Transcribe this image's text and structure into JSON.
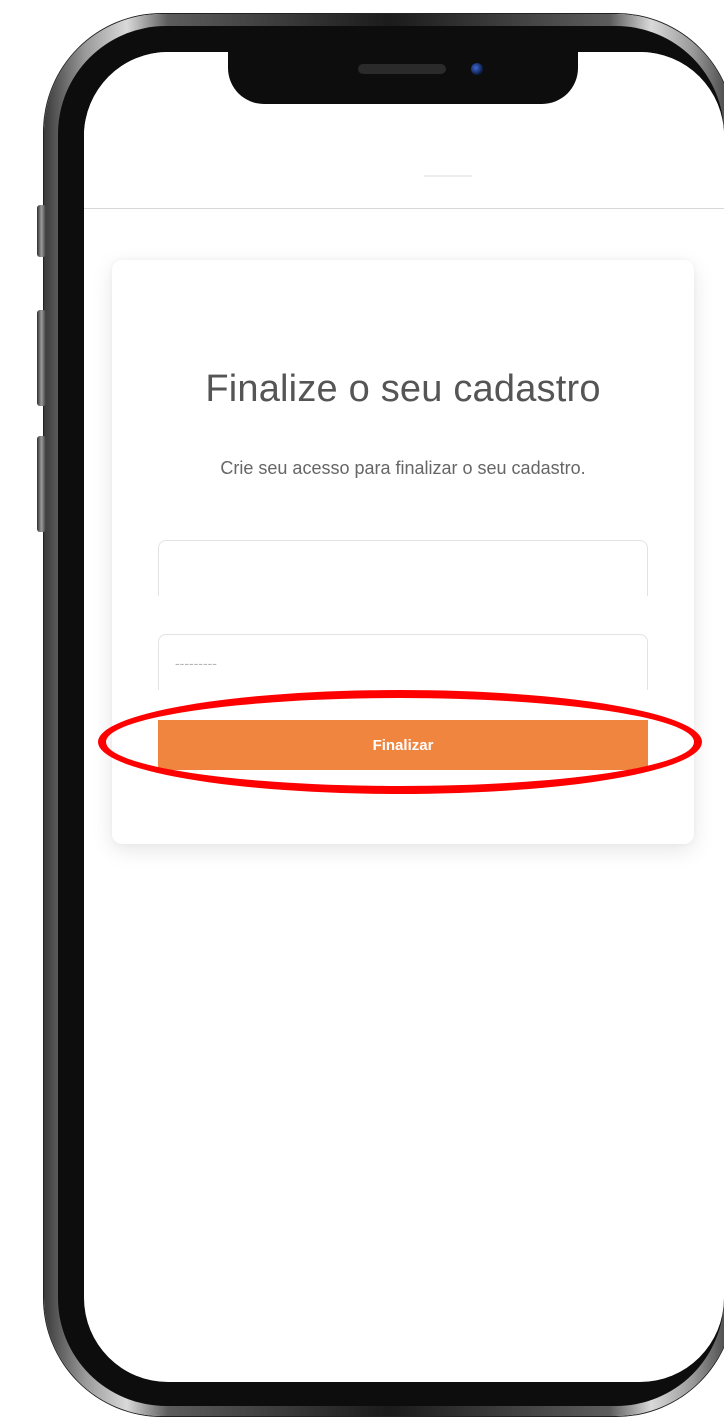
{
  "screen": {
    "title": "Finalize o seu cadastro",
    "subtitle": "Crie seu acesso para finalizar o seu cadastro."
  },
  "form": {
    "email_placeholder": "",
    "password_placeholder": "---------",
    "submit_label": "Finalizar"
  },
  "colors": {
    "accent": "#f0853f",
    "highlight": "#ff0000"
  }
}
